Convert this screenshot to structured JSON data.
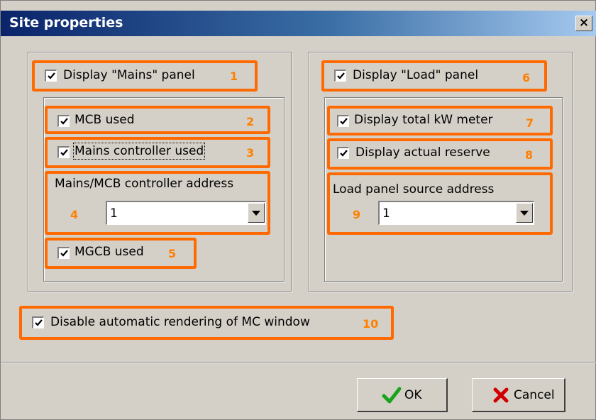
{
  "window": {
    "title": "Site properties",
    "close_glyph": "×"
  },
  "mains": {
    "display_label": "Display \"Mains\" panel",
    "display_num": "1",
    "display_checked": true,
    "mcb_label": "MCB used",
    "mcb_num": "2",
    "controller_label": "Mains controller used",
    "controller_num": "3",
    "address_label": "Mains/MCB controller address",
    "address_num": "4",
    "address_value": "1",
    "mgcb_label": "MGCB used",
    "mgcb_num": "5"
  },
  "load": {
    "display_label": "Display \"Load\" panel",
    "display_num": "6",
    "kw_label": "Display total kW meter",
    "kw_num": "7",
    "reserve_label": "Display actual reserve",
    "reserve_num": "8",
    "source_label": "Load panel source address",
    "source_num": "9",
    "source_value": "1"
  },
  "disable": {
    "label": "Disable automatic rendering of MC window",
    "num": "10"
  },
  "buttons": {
    "ok_label": "OK",
    "cancel_label": "Cancel"
  },
  "colors": {
    "highlight": "#ff6a00",
    "number": "#ff7f00",
    "ok_icon": "#1aa31a",
    "cancel_icon": "#d00000"
  },
  "icons": {
    "ok": "check-icon",
    "cancel": "x-icon",
    "close": "close-icon",
    "dropdown": "chevron-down-icon"
  }
}
